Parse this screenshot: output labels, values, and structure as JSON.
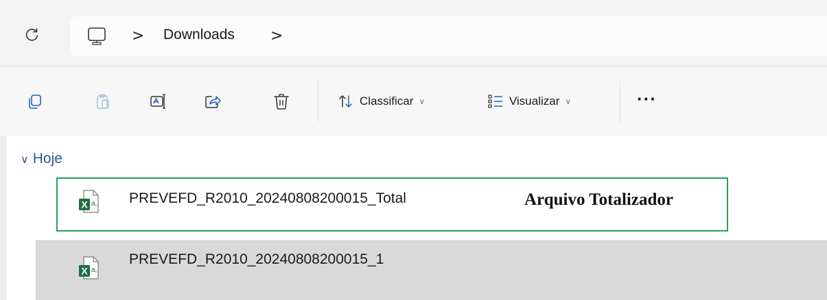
{
  "address_bar": {
    "refresh_icon": "refresh-icon",
    "location_icon": "this-pc-icon",
    "separator_glyph": ">",
    "breadcrumbs": [
      {
        "label": "Downloads"
      }
    ]
  },
  "toolbar": {
    "icons": [
      "copy-icon",
      "paste-icon",
      "rename-icon",
      "share-icon",
      "delete-icon"
    ],
    "sort_label": "Classificar",
    "view_label": "Visualizar",
    "more_label": "···"
  },
  "content": {
    "group_header": "Hoje",
    "files": [
      {
        "name": "PREVEFD_R2010_20240808200015_Total",
        "icon": "excel-file-icon",
        "selected": false
      },
      {
        "name": "PREVEFD_R2010_20240808200015_1",
        "icon": "excel-file-icon",
        "selected": true
      }
    ],
    "annotation": "Arquivo Totalizador"
  },
  "colors": {
    "highlight_border": "#21a35a",
    "group_header": "#2f5597",
    "selected_row": "#d9d9d9",
    "excel_green": "#1d6f42"
  }
}
